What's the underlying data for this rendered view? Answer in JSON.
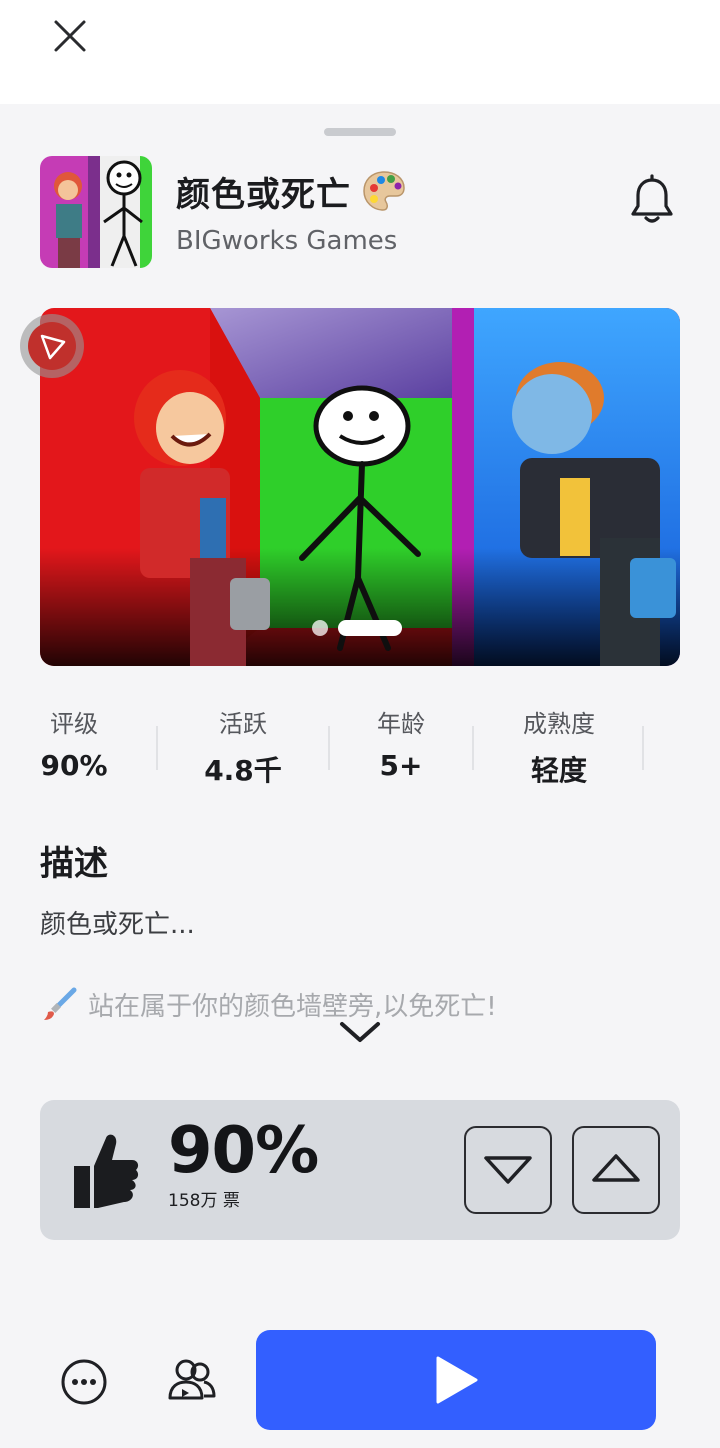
{
  "game": {
    "title": "颜色或死亡",
    "developer": "BIGworks Games"
  },
  "carousel": {
    "slide_count": 2,
    "active_index": 1
  },
  "stats": [
    {
      "label": "评级",
      "value": "90%"
    },
    {
      "label": "活跃",
      "value": "4.8千"
    },
    {
      "label": "年龄",
      "value": "5+"
    },
    {
      "label": "成熟度",
      "value": "轻度"
    }
  ],
  "description": {
    "heading": "描述",
    "line1": "颜色或死亡...",
    "line2": "站在属于你的颜色墙壁旁,以免死亡!"
  },
  "votes": {
    "percent": "90%",
    "count": "158万 票"
  },
  "colors": {
    "play_button": "#335fff",
    "vote_card": "#d7dadf",
    "background": "#f5f5f7"
  },
  "icons": {
    "close": "close-icon",
    "bell": "bell-icon",
    "thumbs_up": "thumbs-up-icon",
    "thumbs_down_vote": "thumbs-down-vote-icon",
    "thumbs_up_vote": "thumbs-up-vote-icon",
    "more": "more-icon",
    "party": "party-icon",
    "play": "play-icon",
    "expand": "chevron-down-icon"
  }
}
